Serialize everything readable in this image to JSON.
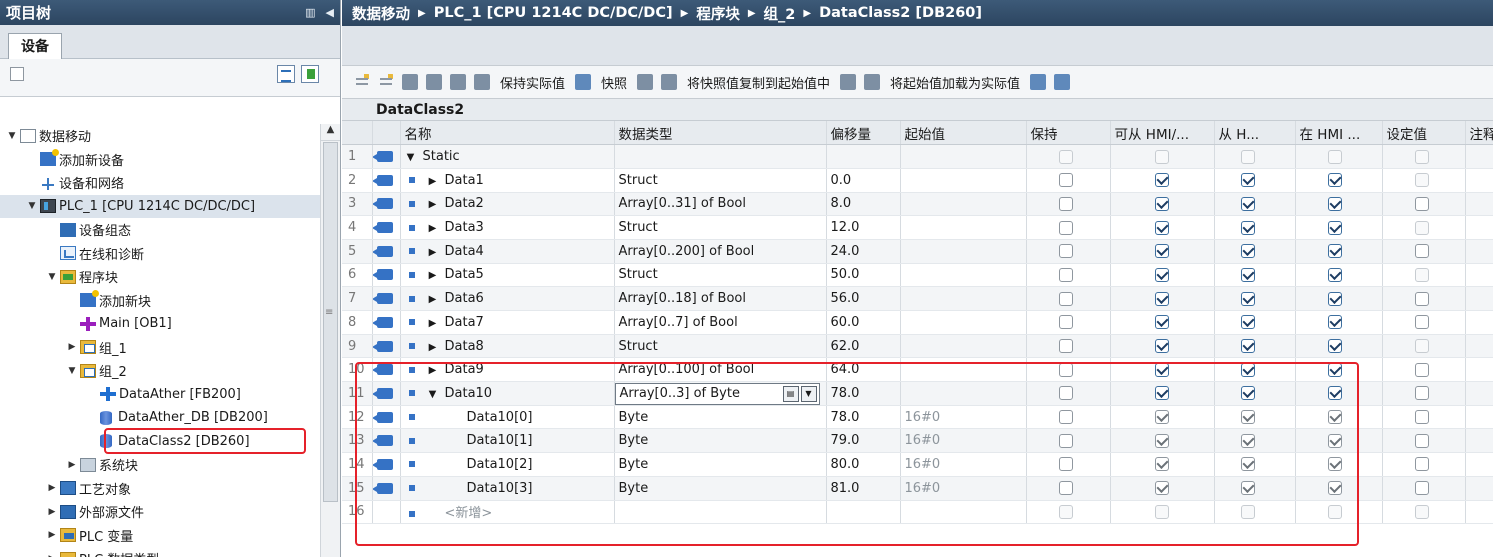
{
  "left_panel": {
    "title": "项目树",
    "tab": "设备",
    "tree": [
      {
        "label": "数据移动",
        "indent": 0,
        "expander": "▼",
        "icon": "doc"
      },
      {
        "label": "添加新设备",
        "indent": 1,
        "expander": "",
        "icon": "add"
      },
      {
        "label": "设备和网络",
        "indent": 1,
        "expander": "",
        "icon": "net"
      },
      {
        "label": "PLC_1 [CPU 1214C DC/DC/DC]",
        "indent": 1,
        "expander": "▼",
        "icon": "plc",
        "selected": true
      },
      {
        "label": "设备组态",
        "indent": 2,
        "expander": "",
        "icon": "dev"
      },
      {
        "label": "在线和诊断",
        "indent": 2,
        "expander": "",
        "icon": "diag"
      },
      {
        "label": "程序块",
        "indent": 2,
        "expander": "▼",
        "icon": "folder"
      },
      {
        "label": "添加新块",
        "indent": 3,
        "expander": "",
        "icon": "add"
      },
      {
        "label": "Main [OB1]",
        "indent": 3,
        "expander": "",
        "icon": "ob"
      },
      {
        "label": "组_1",
        "indent": 3,
        "expander": "▶",
        "icon": "grp"
      },
      {
        "label": "组_2",
        "indent": 3,
        "expander": "▼",
        "icon": "grp"
      },
      {
        "label": "DataAther [FB200]",
        "indent": 4,
        "expander": "",
        "icon": "fb"
      },
      {
        "label": "DataAther_DB [DB200]",
        "indent": 4,
        "expander": "",
        "icon": "db"
      },
      {
        "label": "DataClass2 [DB260]",
        "indent": 4,
        "expander": "",
        "icon": "db"
      },
      {
        "label": "系统块",
        "indent": 3,
        "expander": "▶",
        "icon": "sys"
      },
      {
        "label": "工艺对象",
        "indent": 2,
        "expander": "▶",
        "icon": "tech"
      },
      {
        "label": "外部源文件",
        "indent": 2,
        "expander": "▶",
        "icon": "ext"
      },
      {
        "label": "PLC 变量",
        "indent": 2,
        "expander": "▶",
        "icon": "plcvar"
      },
      {
        "label": "PLC 数据类型",
        "indent": 2,
        "expander": "▶",
        "icon": "plcvar"
      }
    ]
  },
  "breadcrumb": [
    "数据移动",
    "PLC_1 [CPU 1214C DC/DC/DC]",
    "程序块",
    "组_2",
    "DataClass2 [DB260]"
  ],
  "toolbar": {
    "keep_actual": "保持实际值",
    "snapshot": "快照",
    "copy_snapshot": "将快照值复制到起始值中",
    "load_start": "将起始值加载为实际值"
  },
  "db_title": "DataClass2",
  "columns": [
    "名称",
    "数据类型",
    "偏移量",
    "起始值",
    "保持",
    "可从 HMI/...",
    "从 H...",
    "在 HMI ...",
    "设定值",
    "注释"
  ],
  "rows": [
    {
      "n": "1",
      "caret": "▼",
      "sq": false,
      "name": "Static",
      "type": "",
      "offset": "",
      "start": "",
      "level": 0,
      "cbs": [
        "dis",
        "dis",
        "dis",
        "dis",
        "dis"
      ]
    },
    {
      "n": "2",
      "caret": "▶",
      "sq": true,
      "name": "Data1",
      "type": "Struct",
      "offset": "0.0",
      "start": "",
      "level": 1,
      "cbs": [
        "off",
        "on",
        "on",
        "on",
        "dis"
      ]
    },
    {
      "n": "3",
      "caret": "▶",
      "sq": true,
      "name": "Data2",
      "type": "Array[0..31] of Bool",
      "offset": "8.0",
      "start": "",
      "level": 1,
      "cbs": [
        "off",
        "on",
        "on",
        "on",
        "off"
      ]
    },
    {
      "n": "4",
      "caret": "▶",
      "sq": true,
      "name": "Data3",
      "type": "Struct",
      "offset": "12.0",
      "start": "",
      "level": 1,
      "cbs": [
        "off",
        "on",
        "on",
        "on",
        "dis"
      ]
    },
    {
      "n": "5",
      "caret": "▶",
      "sq": true,
      "name": "Data4",
      "type": "Array[0..200] of Bool",
      "offset": "24.0",
      "start": "",
      "level": 1,
      "cbs": [
        "off",
        "on",
        "on",
        "on",
        "off"
      ]
    },
    {
      "n": "6",
      "caret": "▶",
      "sq": true,
      "name": "Data5",
      "type": "Struct",
      "offset": "50.0",
      "start": "",
      "level": 1,
      "cbs": [
        "off",
        "on",
        "on",
        "on",
        "dis"
      ]
    },
    {
      "n": "7",
      "caret": "▶",
      "sq": true,
      "name": "Data6",
      "type": "Array[0..18] of Bool",
      "offset": "56.0",
      "start": "",
      "level": 1,
      "cbs": [
        "off",
        "on",
        "on",
        "on",
        "off"
      ]
    },
    {
      "n": "8",
      "caret": "▶",
      "sq": true,
      "name": "Data7",
      "type": "Array[0..7] of Bool",
      "offset": "60.0",
      "start": "",
      "level": 1,
      "cbs": [
        "off",
        "on",
        "on",
        "on",
        "off"
      ]
    },
    {
      "n": "9",
      "caret": "▶",
      "sq": true,
      "name": "Data8",
      "type": "Struct",
      "offset": "62.0",
      "start": "",
      "level": 1,
      "cbs": [
        "off",
        "on",
        "on",
        "on",
        "dis"
      ]
    },
    {
      "n": "10",
      "caret": "▶",
      "sq": true,
      "name": "Data9",
      "type": "Array[0..100] of Bool",
      "offset": "64.0",
      "start": "",
      "level": 1,
      "cbs": [
        "off",
        "on",
        "on",
        "on",
        "off"
      ]
    },
    {
      "n": "11",
      "caret": "▼",
      "sq": true,
      "name": "Data10",
      "type": "Array[0..3] of Byte",
      "offset": "78.0",
      "start": "",
      "level": 1,
      "editing": true,
      "cbs": [
        "off",
        "on",
        "on",
        "on",
        "off"
      ]
    },
    {
      "n": "12",
      "caret": "",
      "sq": true,
      "name": "Data10[0]",
      "type": "Byte",
      "offset": "78.0",
      "start": "16#0",
      "level": 2,
      "cbs": [
        "off",
        "ongray",
        "ongray",
        "ongray",
        "off"
      ]
    },
    {
      "n": "13",
      "caret": "",
      "sq": true,
      "name": "Data10[1]",
      "type": "Byte",
      "offset": "79.0",
      "start": "16#0",
      "level": 2,
      "cbs": [
        "off",
        "ongray",
        "ongray",
        "ongray",
        "off"
      ]
    },
    {
      "n": "14",
      "caret": "",
      "sq": true,
      "name": "Data10[2]",
      "type": "Byte",
      "offset": "80.0",
      "start": "16#0",
      "level": 2,
      "cbs": [
        "off",
        "ongray",
        "ongray",
        "ongray",
        "off"
      ]
    },
    {
      "n": "15",
      "caret": "",
      "sq": true,
      "name": "Data10[3]",
      "type": "Byte",
      "offset": "81.0",
      "start": "16#0",
      "level": 2,
      "cbs": [
        "off",
        "ongray",
        "ongray",
        "ongray",
        "off"
      ]
    },
    {
      "n": "16",
      "caret": "",
      "sq": true,
      "name": "<新增>",
      "type": "",
      "offset": "",
      "start": "",
      "level": 1,
      "isnew": true,
      "cbs": [
        "dis",
        "dis",
        "dis",
        "dis",
        "dis"
      ]
    }
  ]
}
